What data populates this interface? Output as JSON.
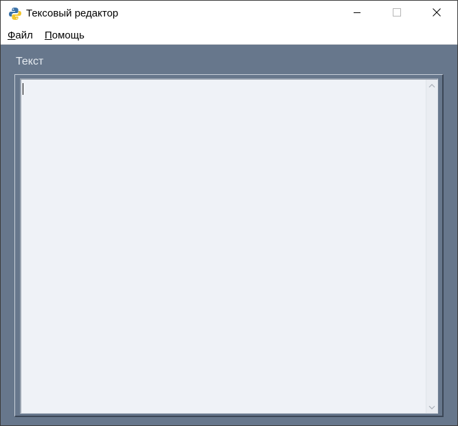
{
  "window": {
    "title": "Тексовый редактор"
  },
  "menu": {
    "file": {
      "accel": "Ф",
      "rest": "айл"
    },
    "help": {
      "accel": "П",
      "rest": "омощь"
    }
  },
  "editor": {
    "frame_label": "Текст",
    "content": ""
  },
  "icons": {
    "app": "python-icon",
    "minimize": "minimize-icon",
    "maximize": "maximize-icon",
    "close": "close-icon",
    "scroll_up": "chevron-up-icon",
    "scroll_down": "chevron-down-icon"
  },
  "colors": {
    "client_background": "#67778c",
    "text_area_background": "#eff2f7"
  }
}
